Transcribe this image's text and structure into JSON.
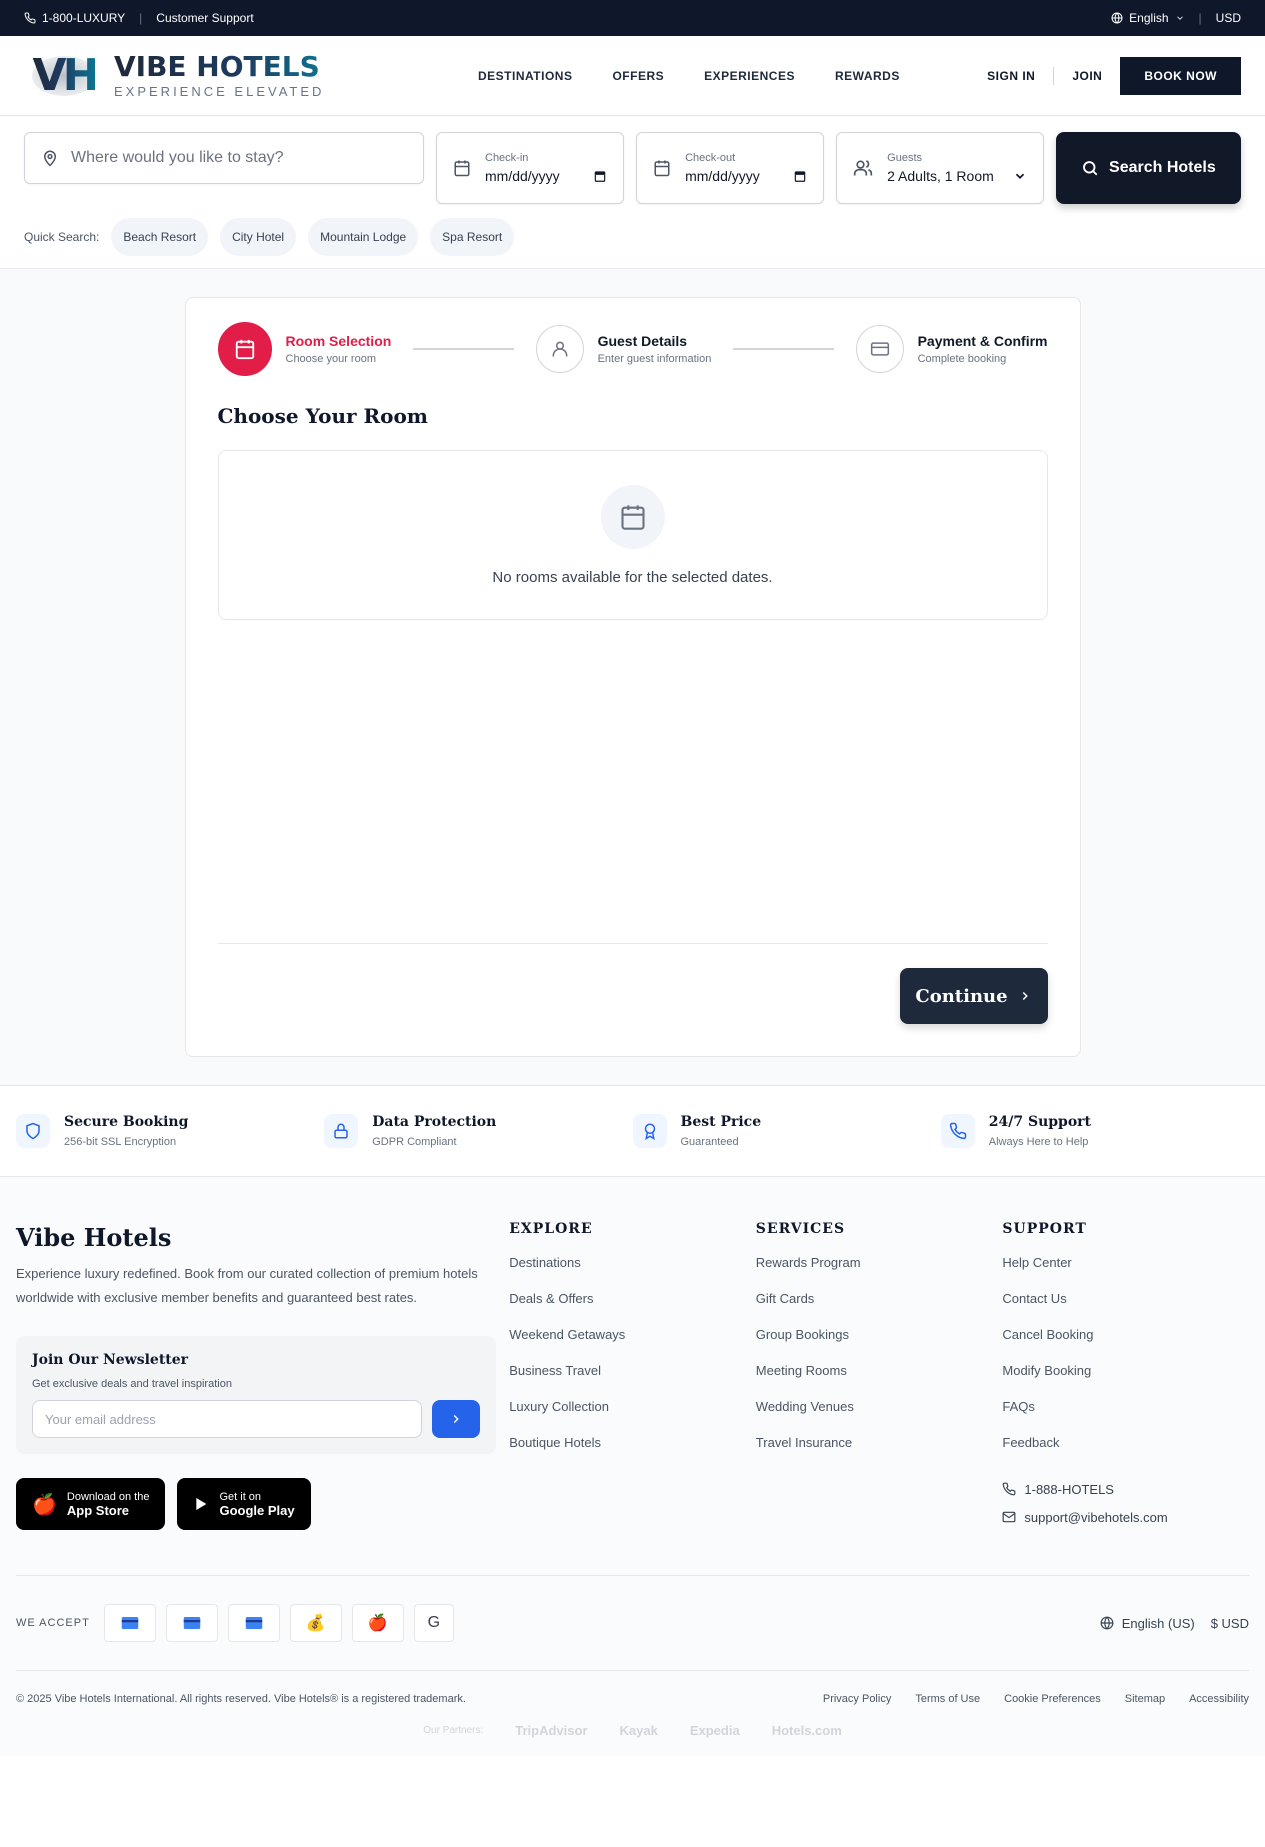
{
  "topbar": {
    "phone": "1-800-LUXURY",
    "support": "Customer Support",
    "language": "English",
    "currency": "USD"
  },
  "brand": {
    "mark": "VH",
    "name": "VIBE HOTELS",
    "tagline": "EXPERIENCE ELEVATED"
  },
  "nav": {
    "items": [
      "DESTINATIONS",
      "OFFERS",
      "EXPERIENCES",
      "REWARDS"
    ],
    "sign_in": "SIGN IN",
    "join": "JOIN",
    "book_now": "BOOK NOW"
  },
  "search": {
    "destination_placeholder": "Where would you like to stay?",
    "checkin_label": "Check-in",
    "checkin_value": "mm/dd/yyyy",
    "checkout_label": "Check-out",
    "checkout_value": "mm/dd/yyyy",
    "guests_label": "Guests",
    "guests_value": "2 Adults, 1 Room",
    "button": "Search Hotels",
    "quick_label": "Quick Search:",
    "quick": [
      "Beach Resort",
      "City Hotel",
      "Mountain Lodge",
      "Spa Resort"
    ]
  },
  "booking": {
    "steps": [
      {
        "title": "Room Selection",
        "sub": "Choose your room"
      },
      {
        "title": "Guest Details",
        "sub": "Enter guest information"
      },
      {
        "title": "Payment & Confirm",
        "sub": "Complete booking"
      }
    ],
    "heading": "Choose Your Room",
    "empty": "No rooms available for the selected dates.",
    "continue": "Continue"
  },
  "features": [
    {
      "title": "Secure Booking",
      "sub": "256-bit SSL Encryption"
    },
    {
      "title": "Data Protection",
      "sub": "GDPR Compliant"
    },
    {
      "title": "Best Price",
      "sub": "Guaranteed"
    },
    {
      "title": "24/7 Support",
      "sub": "Always Here to Help"
    }
  ],
  "footer": {
    "brand": "Vibe Hotels",
    "description": "Experience luxury redefined. Book from our curated collection of premium hotels worldwide with exclusive member benefits and guaranteed best rates.",
    "newsletter_title": "Join Our Newsletter",
    "newsletter_sub": "Get exclusive deals and travel inspiration",
    "email_placeholder": "Your email address",
    "app_store_small": "Download on the",
    "app_store_big": "App Store",
    "google_small": "Get it on",
    "google_big": "Google Play",
    "explore_title": "EXPLORE",
    "explore": [
      "Destinations",
      "Deals & Offers",
      "Weekend Getaways",
      "Business Travel",
      "Luxury Collection",
      "Boutique Hotels"
    ],
    "services_title": "SERVICES",
    "services": [
      "Rewards Program",
      "Gift Cards",
      "Group Bookings",
      "Meeting Rooms",
      "Wedding Venues",
      "Travel Insurance"
    ],
    "support_title": "SUPPORT",
    "support": [
      "Help Center",
      "Contact Us",
      "Cancel Booking",
      "Modify Booking",
      "FAQs",
      "Feedback"
    ],
    "phone": "1-888-HOTELS",
    "email": "support@vibehotels.com",
    "we_accept": "WE ACCEPT",
    "pay_icons": [
      "credit-card-icon",
      "credit-card-icon",
      "credit-card-icon",
      "money-bag-icon",
      "apple-icon",
      "google-icon"
    ],
    "google_glyph": "G",
    "language": "English (US)",
    "currency": "$ USD",
    "copyright": "© 2025 Vibe Hotels International. All rights reserved. Vibe Hotels® is a registered trademark.",
    "legal": [
      "Privacy Policy",
      "Terms of Use",
      "Cookie Preferences",
      "Sitemap",
      "Accessibility"
    ],
    "partners_label": "Our Partners:",
    "partners": [
      "TripAdvisor",
      "Kayak",
      "Expedia",
      "Hotels.com"
    ]
  },
  "colors": {
    "dark": "#0f172a",
    "accent": "#e11d48",
    "blue": "#2563eb"
  }
}
